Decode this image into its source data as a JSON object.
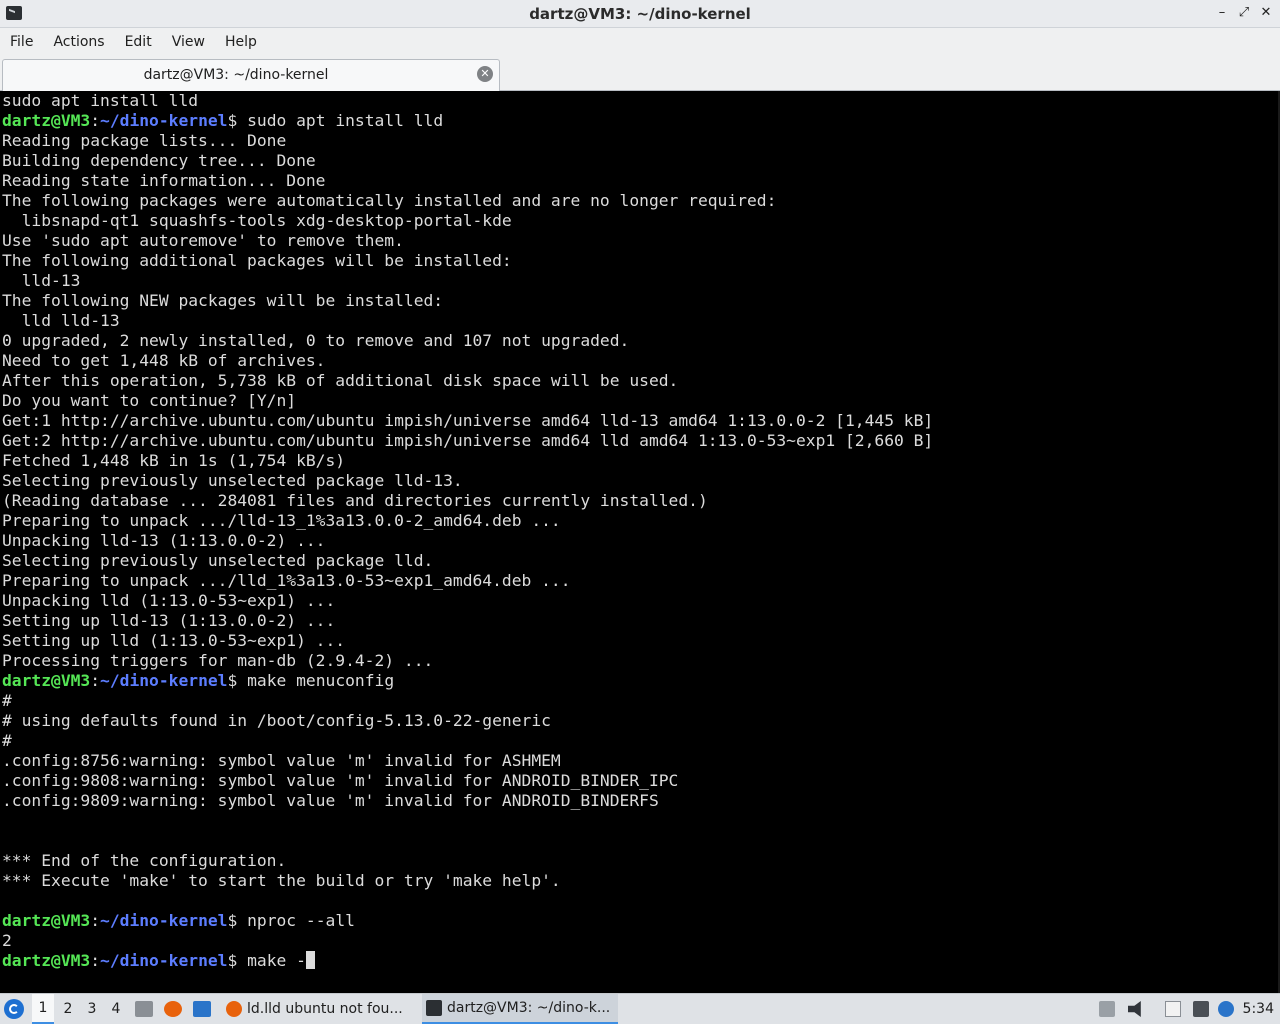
{
  "window": {
    "title": "dartz@VM3: ~/dino-kernel",
    "controls": [
      "–",
      "⤢",
      "✕"
    ]
  },
  "menubar": {
    "items": [
      "File",
      "Actions",
      "Edit",
      "View",
      "Help"
    ]
  },
  "tab": {
    "label": "dartz@VM3: ~/dino-kernel",
    "close_icon": "close-icon"
  },
  "prompt": {
    "user": "dartz@VM3",
    "sep": ":",
    "path": "~/dino-kernel",
    "symbol": "$"
  },
  "terminal": {
    "lines": [
      {
        "type": "out",
        "text": "sudo apt install lld"
      },
      {
        "type": "cmd",
        "text": " sudo apt install lld"
      },
      {
        "type": "out",
        "text": "Reading package lists... Done"
      },
      {
        "type": "out",
        "text": "Building dependency tree... Done"
      },
      {
        "type": "out",
        "text": "Reading state information... Done"
      },
      {
        "type": "out",
        "text": "The following packages were automatically installed and are no longer required:"
      },
      {
        "type": "out",
        "text": "  libsnapd-qt1 squashfs-tools xdg-desktop-portal-kde"
      },
      {
        "type": "out",
        "text": "Use 'sudo apt autoremove' to remove them."
      },
      {
        "type": "out",
        "text": "The following additional packages will be installed:"
      },
      {
        "type": "out",
        "text": "  lld-13"
      },
      {
        "type": "out",
        "text": "The following NEW packages will be installed:"
      },
      {
        "type": "out",
        "text": "  lld lld-13"
      },
      {
        "type": "out",
        "text": "0 upgraded, 2 newly installed, 0 to remove and 107 not upgraded."
      },
      {
        "type": "out",
        "text": "Need to get 1,448 kB of archives."
      },
      {
        "type": "out",
        "text": "After this operation, 5,738 kB of additional disk space will be used."
      },
      {
        "type": "out",
        "text": "Do you want to continue? [Y/n]"
      },
      {
        "type": "out",
        "text": "Get:1 http://archive.ubuntu.com/ubuntu impish/universe amd64 lld-13 amd64 1:13.0.0-2 [1,445 kB]"
      },
      {
        "type": "out",
        "text": "Get:2 http://archive.ubuntu.com/ubuntu impish/universe amd64 lld amd64 1:13.0-53~exp1 [2,660 B]"
      },
      {
        "type": "out",
        "text": "Fetched 1,448 kB in 1s (1,754 kB/s)"
      },
      {
        "type": "out",
        "text": "Selecting previously unselected package lld-13."
      },
      {
        "type": "out",
        "text": "(Reading database ... 284081 files and directories currently installed.)"
      },
      {
        "type": "out",
        "text": "Preparing to unpack .../lld-13_1%3a13.0.0-2_amd64.deb ..."
      },
      {
        "type": "out",
        "text": "Unpacking lld-13 (1:13.0.0-2) ..."
      },
      {
        "type": "out",
        "text": "Selecting previously unselected package lld."
      },
      {
        "type": "out",
        "text": "Preparing to unpack .../lld_1%3a13.0-53~exp1_amd64.deb ..."
      },
      {
        "type": "out",
        "text": "Unpacking lld (1:13.0-53~exp1) ..."
      },
      {
        "type": "out",
        "text": "Setting up lld-13 (1:13.0.0-2) ..."
      },
      {
        "type": "out",
        "text": "Setting up lld (1:13.0-53~exp1) ..."
      },
      {
        "type": "out",
        "text": "Processing triggers for man-db (2.9.4-2) ..."
      },
      {
        "type": "cmd",
        "text": " make menuconfig"
      },
      {
        "type": "out",
        "text": "#"
      },
      {
        "type": "out",
        "text": "# using defaults found in /boot/config-5.13.0-22-generic"
      },
      {
        "type": "out",
        "text": "#"
      },
      {
        "type": "out",
        "text": ".config:8756:warning: symbol value 'm' invalid for ASHMEM"
      },
      {
        "type": "out",
        "text": ".config:9808:warning: symbol value 'm' invalid for ANDROID_BINDER_IPC"
      },
      {
        "type": "out",
        "text": ".config:9809:warning: symbol value 'm' invalid for ANDROID_BINDERFS"
      },
      {
        "type": "out",
        "text": ""
      },
      {
        "type": "out",
        "text": ""
      },
      {
        "type": "out",
        "text": "*** End of the configuration."
      },
      {
        "type": "out",
        "text": "*** Execute 'make' to start the build or try 'make help'."
      },
      {
        "type": "out",
        "text": ""
      },
      {
        "type": "cmd",
        "text": " nproc --all"
      },
      {
        "type": "out",
        "text": "2"
      },
      {
        "type": "input",
        "text": " make -"
      }
    ]
  },
  "taskbar": {
    "start_icon": "lubuntu-start-icon",
    "workspaces": [
      "1",
      "2",
      "3",
      "4"
    ],
    "active_workspace": "1",
    "quicklaunch": [
      {
        "icon": "file-manager-icon",
        "color": "#8a8f95"
      },
      {
        "icon": "firefox-icon",
        "color": "#e8620c"
      },
      {
        "icon": "desktop-icon",
        "color": "#2a74c9"
      }
    ],
    "tasks": [
      {
        "label": "ld.lld ubuntu not fou...",
        "icon": "firefox-icon",
        "color": "#e8620c",
        "active": false
      },
      {
        "label": "dartz@VM3: ~/dino-k...",
        "icon": "terminal-icon",
        "color": "#2b2f33",
        "active": true
      }
    ],
    "tray": [
      "clipboard-icon",
      "volume-icon",
      "files-icon",
      "network-icon",
      "update-icon"
    ],
    "clock": "5:34"
  }
}
